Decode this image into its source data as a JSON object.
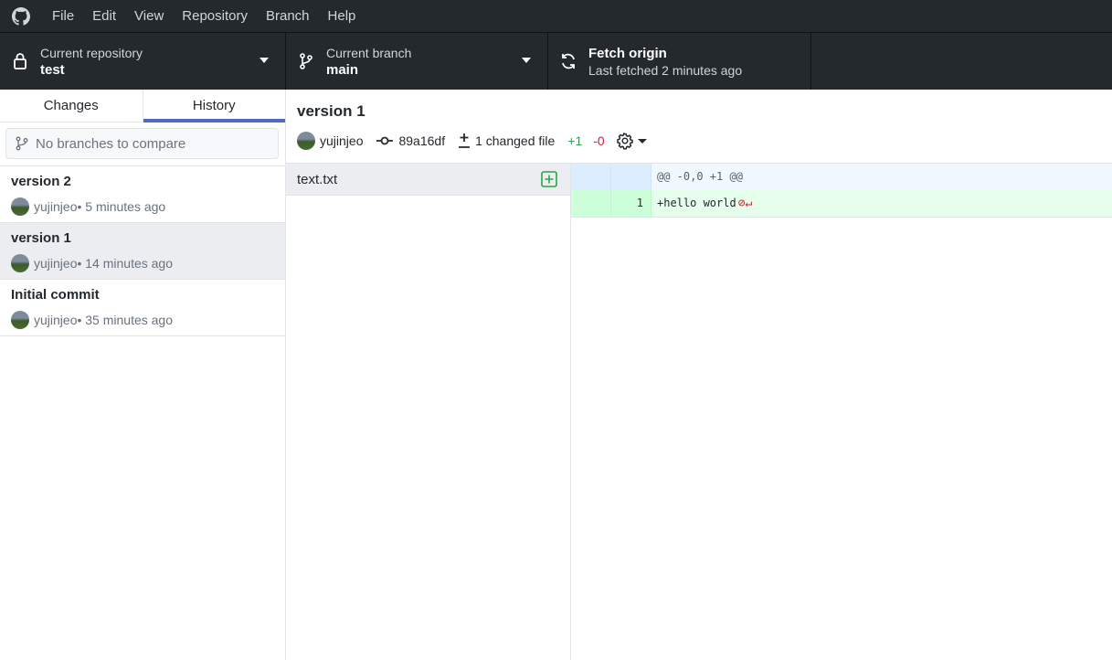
{
  "menu": {
    "items": [
      "File",
      "Edit",
      "View",
      "Repository",
      "Branch",
      "Help"
    ]
  },
  "toolbar": {
    "repository": {
      "label": "Current repository",
      "value": "test"
    },
    "branch": {
      "label": "Current branch",
      "value": "main"
    },
    "fetch": {
      "label": "Fetch origin",
      "value": "Last fetched 2 minutes ago"
    }
  },
  "sidebar": {
    "tabs": [
      {
        "label": "Changes",
        "active": false
      },
      {
        "label": "History",
        "active": true
      }
    ],
    "compare_placeholder": "No branches to compare",
    "commits": [
      {
        "title": "version 2",
        "author": "yujinjeo",
        "time": " • 5 minutes ago",
        "selected": false
      },
      {
        "title": "version 1",
        "author": "yujinjeo",
        "time": " • 14 minutes ago",
        "selected": true
      },
      {
        "title": "Initial commit",
        "author": "yujinjeo",
        "time": " • 35 minutes ago",
        "selected": false
      }
    ]
  },
  "commit": {
    "title": "version 1",
    "author": "yujinjeo",
    "sha": "89a16df",
    "changed_files": "1 changed file",
    "additions": "+1",
    "deletions": "-0"
  },
  "files": [
    {
      "name": "text.txt",
      "status": "added"
    }
  ],
  "diff": {
    "hunk_header": "@@ -0,0 +1 @@",
    "lines": [
      {
        "old": "",
        "new": "1",
        "text": "+hello world"
      }
    ]
  },
  "colors": {
    "toolbar_bg": "#24292e",
    "accent": "#4b6cc2",
    "added": "#28a745",
    "deleted": "#cb2431"
  }
}
